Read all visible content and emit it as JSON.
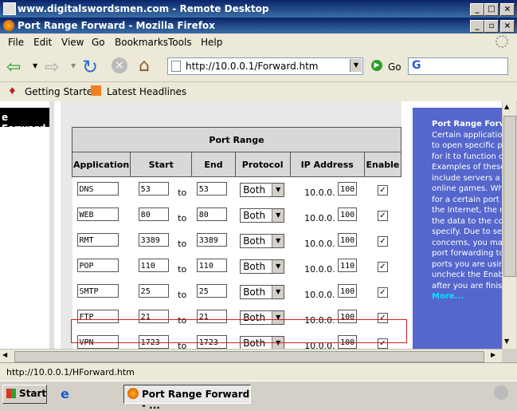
{
  "rd_window": {
    "title": "www.digitalswordsmen.com - Remote Desktop"
  },
  "ff_window": {
    "title": "Port Range Forward - Mozilla Firefox"
  },
  "menu": [
    "File",
    "Edit",
    "View",
    "Go",
    "Bookmarks",
    "Tools",
    "Help"
  ],
  "nav": {
    "url": "http://10.0.0.1/Forward.htm",
    "go_label": "Go",
    "search_value": "G"
  },
  "bookmarks": [
    "Getting Started",
    "Latest Headlines"
  ],
  "leftnav": {
    "label": "e Forward"
  },
  "table": {
    "caption": "Port Range",
    "headers": [
      "Application",
      "Start",
      "End",
      "Protocol",
      "IP Address",
      "Enable"
    ],
    "ip_prefix": "10.0.0.",
    "to_label": "to",
    "rows": [
      {
        "app": "DNS",
        "start": "53",
        "end": "53",
        "protocol": "Both",
        "ip": "100",
        "enabled": true
      },
      {
        "app": "WEB",
        "start": "80",
        "end": "80",
        "protocol": "Both",
        "ip": "100",
        "enabled": true
      },
      {
        "app": "RMT",
        "start": "3389",
        "end": "3389",
        "protocol": "Both",
        "ip": "100",
        "enabled": true
      },
      {
        "app": "POP",
        "start": "110",
        "end": "110",
        "protocol": "Both",
        "ip": "110",
        "enabled": true
      },
      {
        "app": "SMTP",
        "start": "25",
        "end": "25",
        "protocol": "Both",
        "ip": "100",
        "enabled": true
      },
      {
        "app": "FTP",
        "start": "21",
        "end": "21",
        "protocol": "Both",
        "ip": "100",
        "enabled": true
      },
      {
        "app": "VPN",
        "start": "1723",
        "end": "1723",
        "protocol": "Both",
        "ip": "100",
        "enabled": true
      }
    ]
  },
  "sidebar": {
    "title": "Port Range Forv",
    "lines": [
      "Certain application",
      "to open specific p",
      "for it to function c",
      "Examples of these",
      "include servers a",
      "online games. Wh",
      "for a certain port",
      "the Internet, the ro",
      "the data to the co",
      "specify. Due to se",
      "concerns, you ma",
      "port forwarding to",
      "ports you are usin",
      "uncheck the Enab",
      "after you are finis"
    ],
    "more": "More..."
  },
  "status": {
    "text": "http://10.0.0.1/HForward.htm"
  },
  "taskbar": {
    "start": "Start",
    "task": "Port Range Forward - ..."
  }
}
